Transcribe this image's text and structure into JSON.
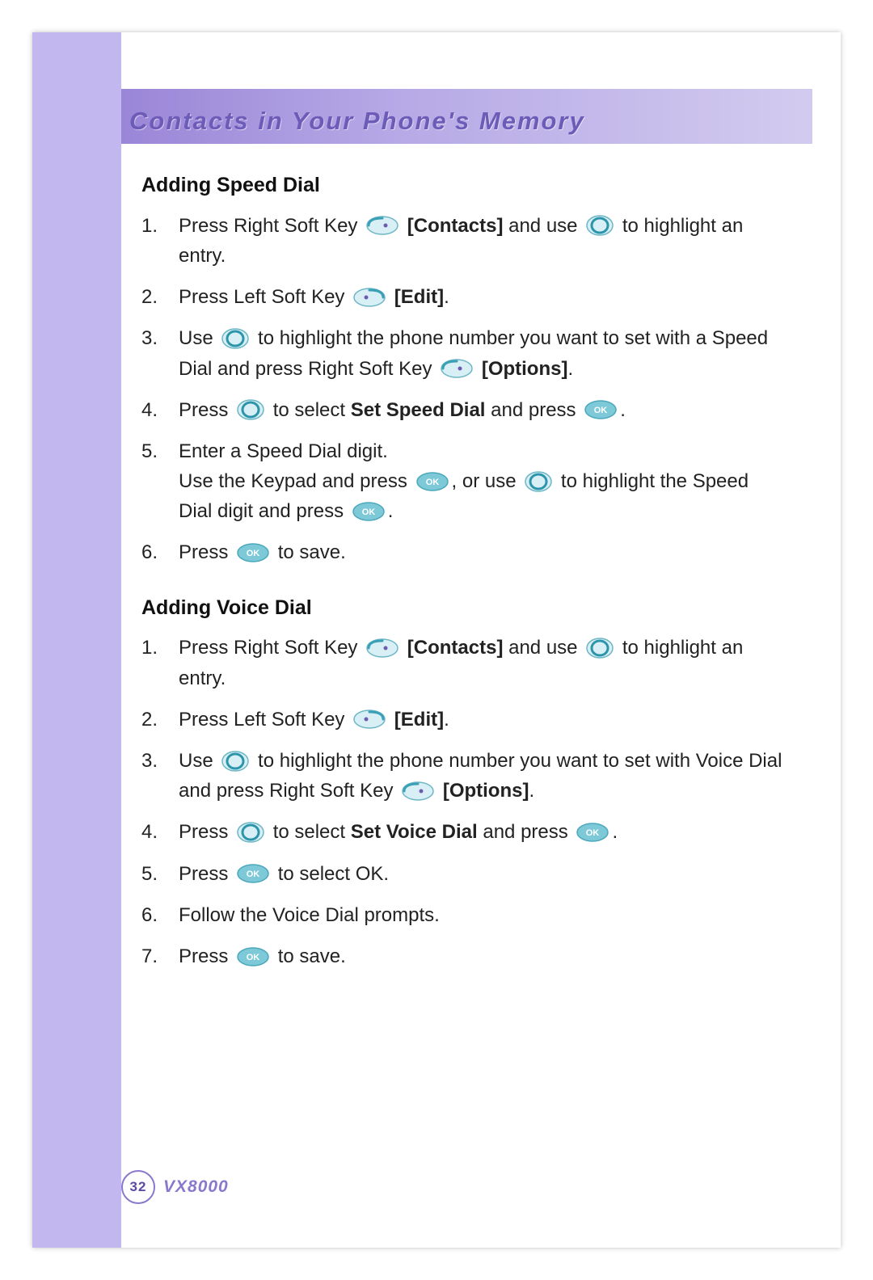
{
  "banner": {
    "title": "Contacts in Your Phone's Memory"
  },
  "sections": {
    "speed": {
      "heading": "Adding Speed Dial",
      "s1a": "Press Right Soft Key ",
      "s1b": "[Contacts]",
      "s1c": " and use ",
      "s1d": " to highlight an entry.",
      "s2a": "Press Left Soft Key ",
      "s2b": "[Edit]",
      "s2c": ".",
      "s3a": "Use ",
      "s3b": " to highlight the phone number you want to set with a Speed Dial and press Right Soft Key ",
      "s3c": "[Options]",
      "s3d": ".",
      "s4a": "Press ",
      "s4b": " to select ",
      "s4c": "Set Speed Dial",
      "s4d": " and press ",
      "s4e": ".",
      "s5a": "Enter a Speed Dial digit.",
      "s5b": "Use the Keypad and press ",
      "s5c": ", or use ",
      "s5d": " to highlight the Speed Dial digit and press ",
      "s5e": ".",
      "s6a": "Press ",
      "s6b": " to save."
    },
    "voice": {
      "heading": "Adding Voice Dial",
      "s1a": "Press Right Soft Key ",
      "s1b": "[Contacts]",
      "s1c": " and use ",
      "s1d": " to highlight an entry.",
      "s2a": "Press Left Soft Key ",
      "s2b": "[Edit]",
      "s2c": ".",
      "s3a": "Use ",
      "s3b": " to highlight the phone number you want to set with Voice Dial and press Right Soft Key ",
      "s3c": "[Options]",
      "s3d": ".",
      "s4a": "Press ",
      "s4b": " to select ",
      "s4c": "Set Voice Dial",
      "s4d": " and press ",
      "s4e": ".",
      "s5a": "Press ",
      "s5b": " to select OK.",
      "s6": "Follow the Voice Dial prompts.",
      "s7a": "Press ",
      "s7b": " to save."
    }
  },
  "numbers": {
    "n1": "1.",
    "n2": "2.",
    "n3": "3.",
    "n4": "4.",
    "n5": "5.",
    "n6": "6.",
    "n7": "7."
  },
  "footer": {
    "page": "32",
    "model": "VX8000"
  },
  "icons": {
    "ok_text": "OK"
  }
}
